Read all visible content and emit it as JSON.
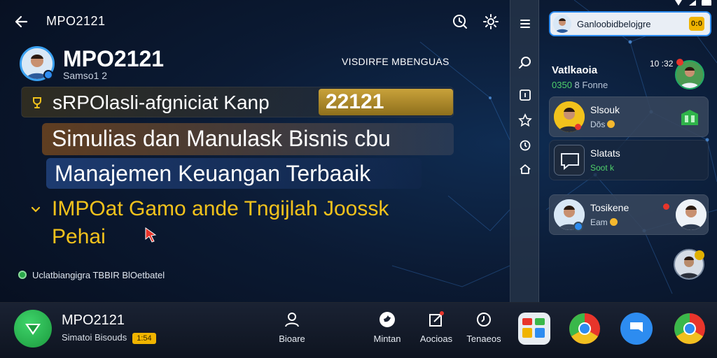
{
  "colors": {
    "accent": "#2d8cf0",
    "gold": "#f2c21c",
    "green": "#4fd06a",
    "background": "#0b1a33"
  },
  "topbar": {
    "title": "MPO2121",
    "back_icon": "arrow-left-icon",
    "icons": [
      "clock-search-icon",
      "settings-gear-icon"
    ]
  },
  "profile": {
    "name": "MPO2121",
    "subtitle": "Samso1 2",
    "right_label": "VISDIRFE MBENGUAS"
  },
  "promo": {
    "row1_text": "sRPOlasli-afgniciat Kanp",
    "row1_badge": "22121",
    "row2_text": "Simulias dan Manulask Bisnis cbu",
    "row3_text": "Manajemen Keuangan Terbaaik",
    "highlight_line1": "IMPOat Gamo ande Tngijlah Joossk",
    "highlight_line2": "Pehai",
    "footer_note": "Uclatbiangigra TBBIR BlOetbatel"
  },
  "rail": {
    "icons": [
      "menu-icon",
      "search-icon",
      "document-icon",
      "star-icon",
      "timer-icon",
      "home-icon"
    ]
  },
  "panel": {
    "search_text": "Ganloobidbelojgre",
    "search_badge": "0:0",
    "top_contact": {
      "name": "Vatlkaoia",
      "sub_green": "0350",
      "sub_rest": "8 Fonne",
      "time": "10 :32"
    },
    "cards": [
      {
        "name": "Slsouk",
        "sub": "Dõs"
      },
      {
        "name": "Slatats",
        "sub": "Soot k"
      },
      {
        "name": "Tosikene",
        "sub": "Eam"
      }
    ],
    "card1_badge_icon": "green-box-icon"
  },
  "dock": {
    "title": "MPO2121",
    "subtitle": "Simatoi Bisouds",
    "badge": "1:54",
    "nav": [
      {
        "label": "Bioare",
        "icon": "person-icon"
      },
      {
        "label": "Mintan",
        "icon": "bird-icon"
      },
      {
        "label": "Aocioas",
        "icon": "share-icon"
      },
      {
        "label": "Tenaeos",
        "icon": "clock-icon"
      }
    ],
    "apps": [
      "gallery-app-icon",
      "chrome-icon",
      "messages-app-icon",
      "chrome-icon"
    ]
  }
}
